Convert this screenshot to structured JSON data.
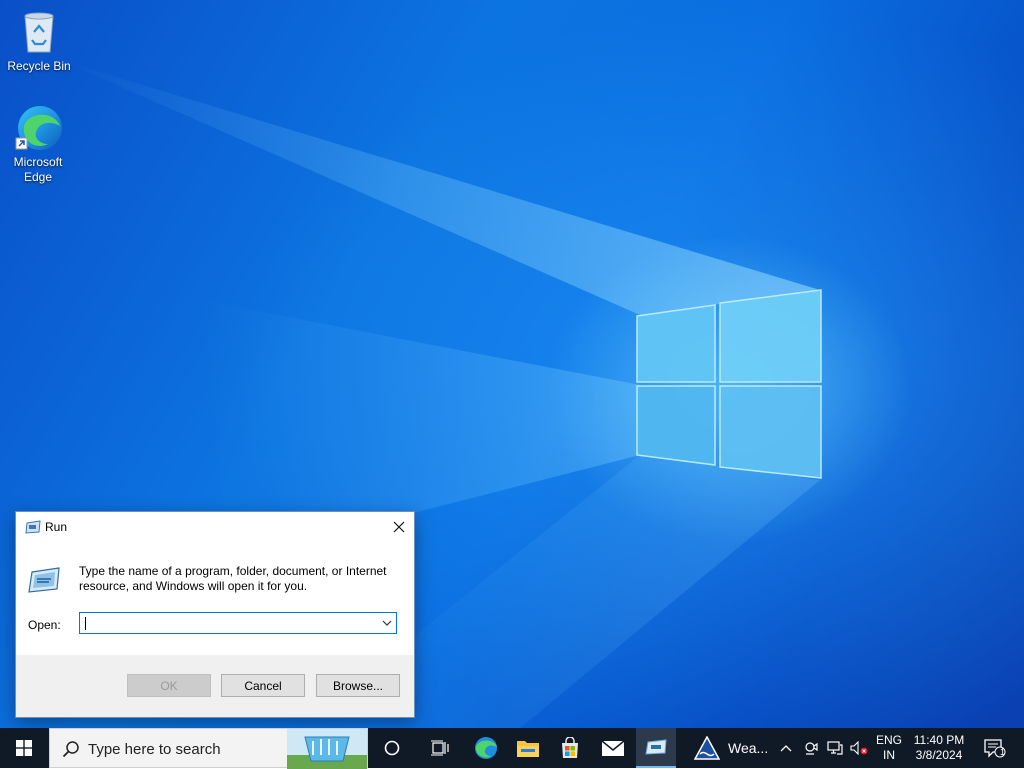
{
  "desktop": {
    "icons": [
      {
        "label": "Recycle Bin",
        "icon": "recycle-bin-icon"
      },
      {
        "label": "Microsoft\nEdge",
        "icon": "edge-icon"
      }
    ]
  },
  "run_dialog": {
    "title": "Run",
    "description": "Type the name of a program, folder, document, or Internet resource, and Windows will open it for you.",
    "open_label": "Open:",
    "open_value": "",
    "ok_label": "OK",
    "cancel_label": "Cancel",
    "browse_label": "Browse..."
  },
  "taskbar": {
    "search_placeholder": "Type here to search",
    "weather_label": "Wea...",
    "language_top": "ENG",
    "language_bottom": "IN",
    "time": "11:40 PM",
    "date": "3/8/2024",
    "notification_count": "1"
  },
  "colors": {
    "taskbar_bg": "#101a26",
    "accent": "#0078d7"
  }
}
